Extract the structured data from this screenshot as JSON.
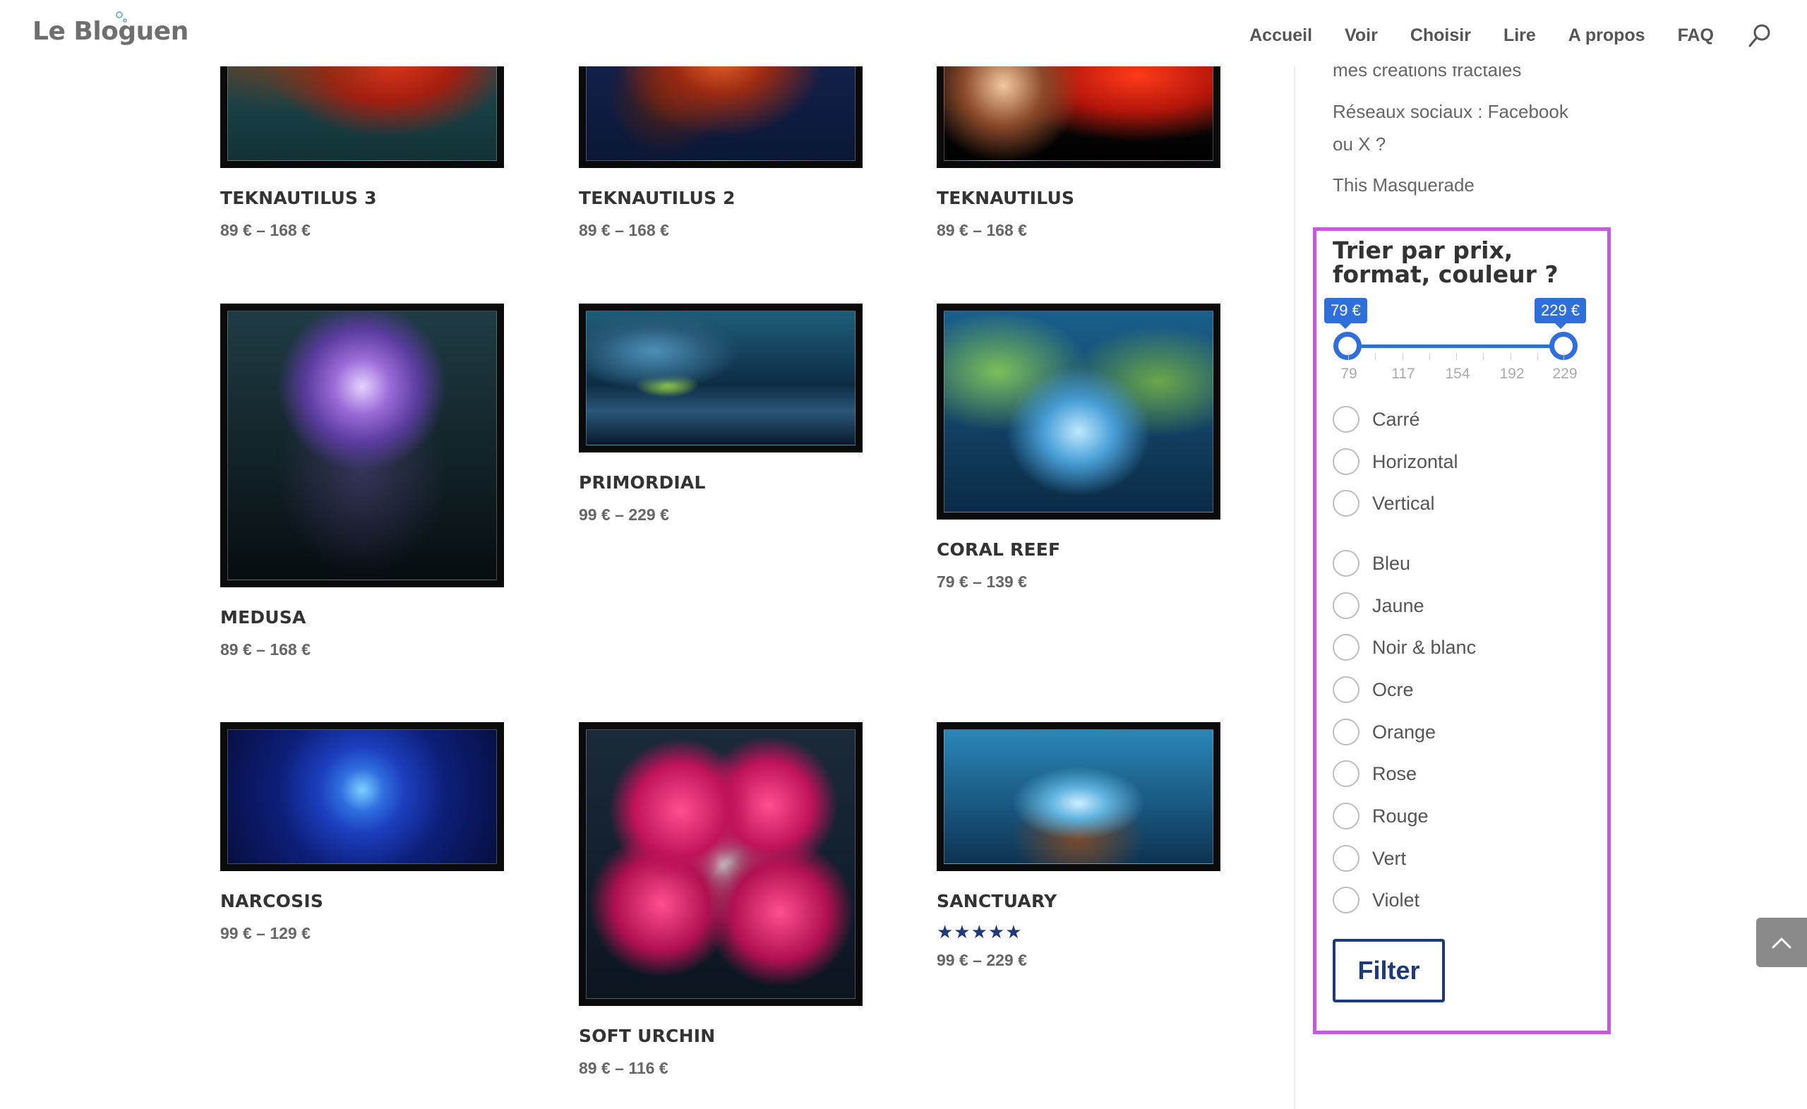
{
  "header": {
    "logo_text": "Le Bloguen",
    "nav": [
      "Accueil",
      "Voir",
      "Choisir",
      "Lire",
      "A propos",
      "FAQ"
    ]
  },
  "icons": {
    "search": "search-icon",
    "back_to_top": "chevron-up-icon",
    "radio": "radio-circle-icon",
    "star": "star-icon"
  },
  "colors": {
    "accent": "#2f6fdc",
    "highlight_border": "#c45bdc",
    "button_text": "#1f3a7a",
    "star": "#1f3a7a"
  },
  "products": [
    {
      "name": "TEKNAUTILUS 3",
      "price": "89 €  –  168 €"
    },
    {
      "name": "TEKNAUTILUS 2",
      "price": "89 €  –  168 €"
    },
    {
      "name": "TEKNAUTILUS",
      "price": "89 €  –  168 €"
    },
    {
      "name": "MEDUSA",
      "price": "89 €  –  168 €"
    },
    {
      "name": "PRIMORDIAL",
      "price": "99 €  –  229 €"
    },
    {
      "name": "CORAL REEF",
      "price": "79 €  –  139 €"
    },
    {
      "name": "NARCOSIS",
      "price": "99 €  –  129 €"
    },
    {
      "name": "SOFT URCHIN",
      "price": "89 €  –  116 €"
    },
    {
      "name": "SANCTUARY",
      "price": "99 €  –  229 €",
      "rating_stars": 5,
      "stars_text": "★★★★★"
    }
  ],
  "sidebar": {
    "recent_posts": [
      "mes créations fractales",
      "Réseaux sociaux : Facebook ou X ?",
      "This Masquerade"
    ],
    "filter": {
      "title": "Trier par prix, format, couleur ?",
      "price_min_label": "79 €",
      "price_max_label": "229 €",
      "range_min": 79,
      "range_max": 229,
      "tick_labels": [
        "79",
        "117",
        "154",
        "192",
        "229"
      ],
      "formats": [
        "Carré",
        "Horizontal",
        "Vertical"
      ],
      "colors": [
        "Bleu",
        "Jaune",
        "Noir & blanc",
        "Ocre",
        "Orange",
        "Rose",
        "Rouge",
        "Vert",
        "Violet"
      ],
      "button_label": "Filter"
    }
  }
}
